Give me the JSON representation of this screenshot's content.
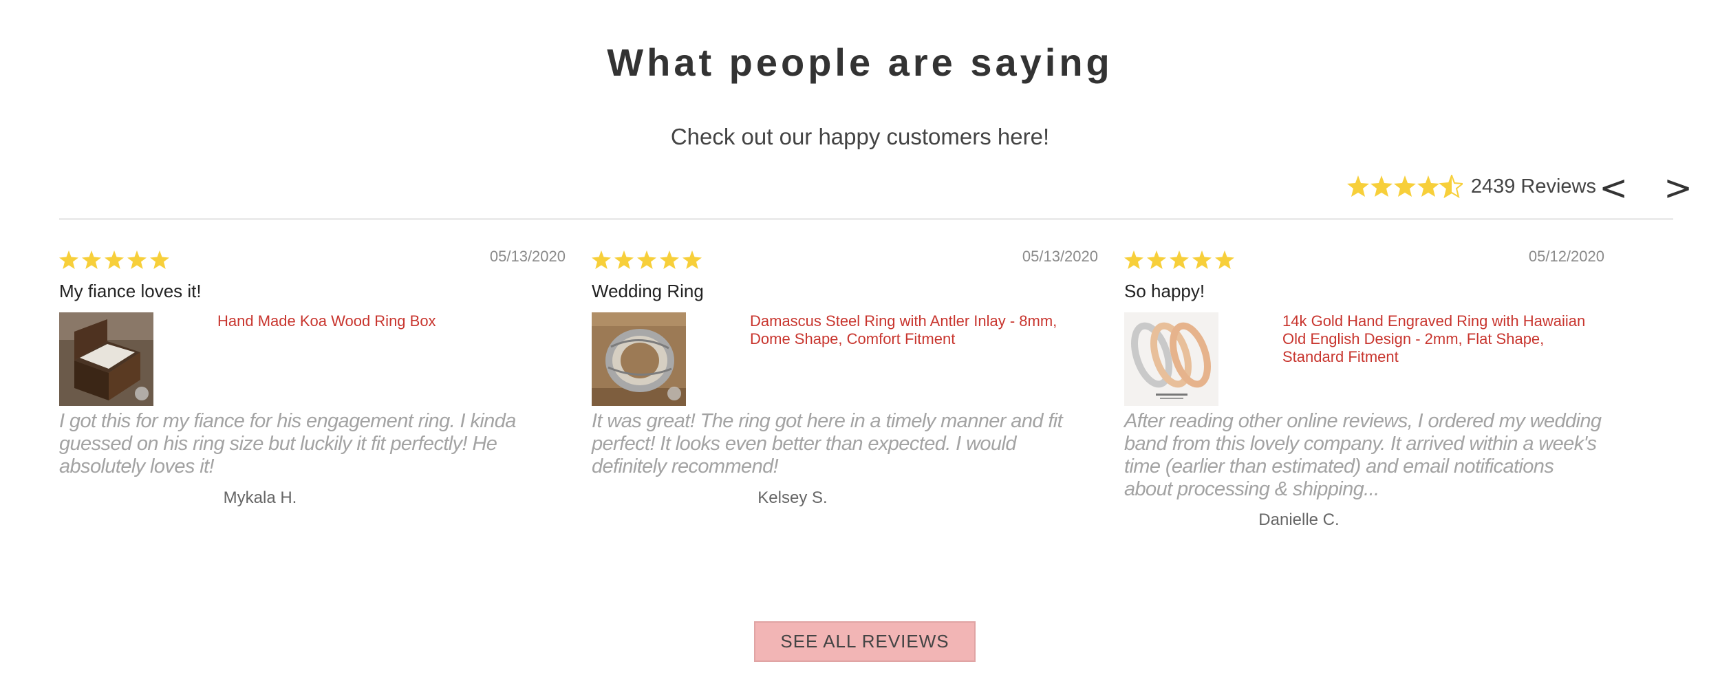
{
  "header": {
    "title": "What people are saying",
    "subtitle": "Check out our happy customers here!"
  },
  "summary": {
    "rating": 4.5,
    "count_label": "2439 Reviews",
    "prev_label": "<",
    "next_label": ">"
  },
  "colors": {
    "star": "#f7cf3a",
    "product_link": "#c8352e",
    "button_bg": "#f2b5b5"
  },
  "reviews": [
    {
      "rating": 5,
      "date": "05/13/2020",
      "title": "My fiance loves it!",
      "product": "Hand Made Koa Wood Ring Box",
      "image": "ring-box-icon",
      "body": "I got this for my fiance for his engagement ring. I kinda guessed on his ring size but luckily it fit perfectly! He absolutely loves it!",
      "author": "Mykala H."
    },
    {
      "rating": 5,
      "date": "05/13/2020",
      "title": "Wedding Ring",
      "product": "Damascus Steel Ring with Antler Inlay - 8mm, Dome Shape, Comfort Fitment",
      "image": "damascus-ring-icon",
      "body": "It was great! The ring got here in a timely manner and fit perfect! It looks even better than expected. I would definitely recommend!",
      "author": "Kelsey S."
    },
    {
      "rating": 5,
      "date": "05/12/2020",
      "title": "So happy!",
      "product": "14k Gold Hand Engraved Ring with Hawaiian Old English Design - 2mm, Flat Shape, Standard Fitment",
      "image": "gold-rings-icon",
      "body": "After reading other online reviews, I ordered my wedding band from this lovely company. It arrived within a week's time (earlier than estimated) and email notifications about processing & shipping...",
      "author": "Danielle C."
    }
  ],
  "footer": {
    "button_label": "SEE ALL REVIEWS"
  }
}
